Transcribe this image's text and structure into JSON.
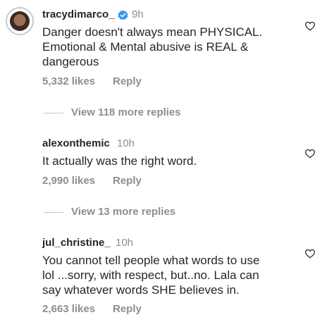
{
  "comments": [
    {
      "username": "tracydimarco_",
      "verified": true,
      "time": "9h",
      "lines": [
        "Danger doesn't always mean PHYSICAL.",
        "Emotional & Mental abusive is REAL &",
        "dangerous"
      ],
      "likes": "5,332 likes",
      "reply": "Reply",
      "view_replies": "View 118 more replies"
    },
    {
      "username": "alexonthemic",
      "time": "10h",
      "lines": [
        "It actually was the right word."
      ],
      "likes": "2,990 likes",
      "reply": "Reply",
      "view_replies": "View 13 more replies"
    },
    {
      "username": "jul_christine_",
      "time": "10h",
      "lines": [
        "You cannot tell people what words to use",
        "lol ...sorry, with respect, but..no. Lala can",
        "say whatever words SHE believes in."
      ],
      "likes": "2,663 likes",
      "reply": "Reply"
    }
  ],
  "colors": {
    "text": "#262626",
    "muted": "#8e8e8e",
    "verified_blue": "#3897f0"
  },
  "icons": {
    "like": "heart-outline-icon",
    "verified": "verified-badge-icon"
  }
}
